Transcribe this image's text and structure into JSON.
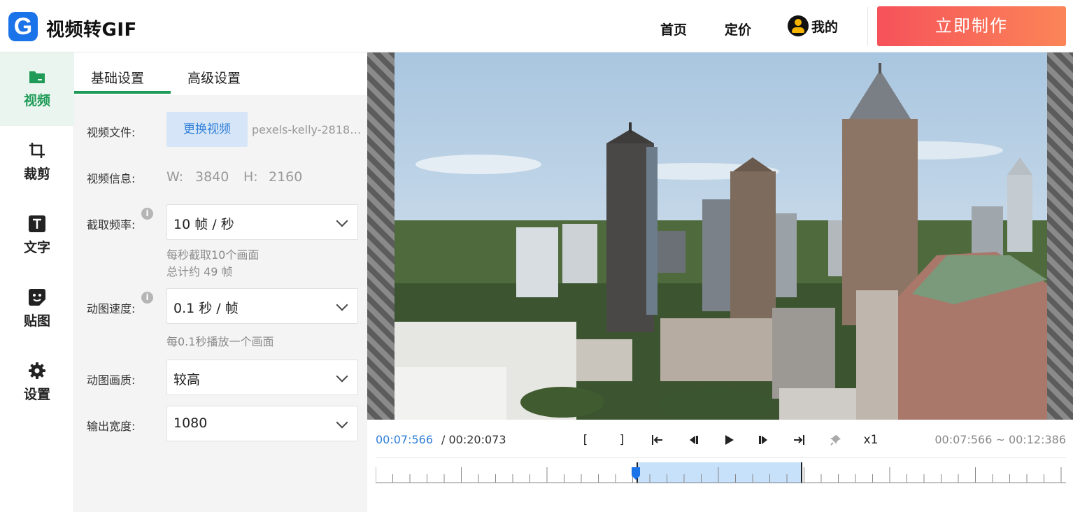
{
  "header": {
    "logo_letter": "G",
    "app_title": "视频转GIF",
    "nav_home": "首页",
    "nav_pricing": "定价",
    "nav_mine": "我的",
    "cta_label": "立即制作"
  },
  "rail": {
    "items": [
      {
        "label": "视频",
        "icon": "video-folder-icon"
      },
      {
        "label": "裁剪",
        "icon": "crop-icon"
      },
      {
        "label": "文字",
        "icon": "text-icon"
      },
      {
        "label": "贴图",
        "icon": "sticker-icon"
      },
      {
        "label": "设置",
        "icon": "gear-icon"
      }
    ]
  },
  "tabs": {
    "basic": "基础设置",
    "advanced": "高级设置"
  },
  "form": {
    "video_file_label": "视频文件:",
    "replace_button": "更换视频",
    "filename": "pexels-kelly-2818…",
    "video_info_label": "视频信息:",
    "width_label": "W:",
    "width_value": "3840",
    "height_label": "H:",
    "height_value": "2160",
    "framerate_label": "截取频率:",
    "framerate_value": "10 帧 / 秒",
    "framerate_hint1": "每秒截取10个画面",
    "framerate_hint2": "总计约 49 帧",
    "speed_label": "动图速度:",
    "speed_value": "0.1 秒 / 帧",
    "speed_hint": "每0.1秒播放一个画面",
    "quality_label": "动图画质:",
    "quality_value": "较高",
    "width_out_label": "输出宽度:",
    "width_out_value": "1080",
    "info_glyph": "i"
  },
  "player": {
    "current_time": "00:07:566",
    "total_time": "/ 00:20:073",
    "mark_in": "[",
    "mark_out": "]",
    "speed": "x1",
    "range": "00:07:566 ~ 00:12:386",
    "selection_start_fraction": 0.377,
    "selection_end_fraction": 0.617
  },
  "colors": {
    "accent_green": "#1f9b57",
    "accent_blue": "#2f7ed8",
    "cta_start": "#f6525a",
    "cta_end": "#fb8558",
    "selection": "#c7e1fa"
  }
}
